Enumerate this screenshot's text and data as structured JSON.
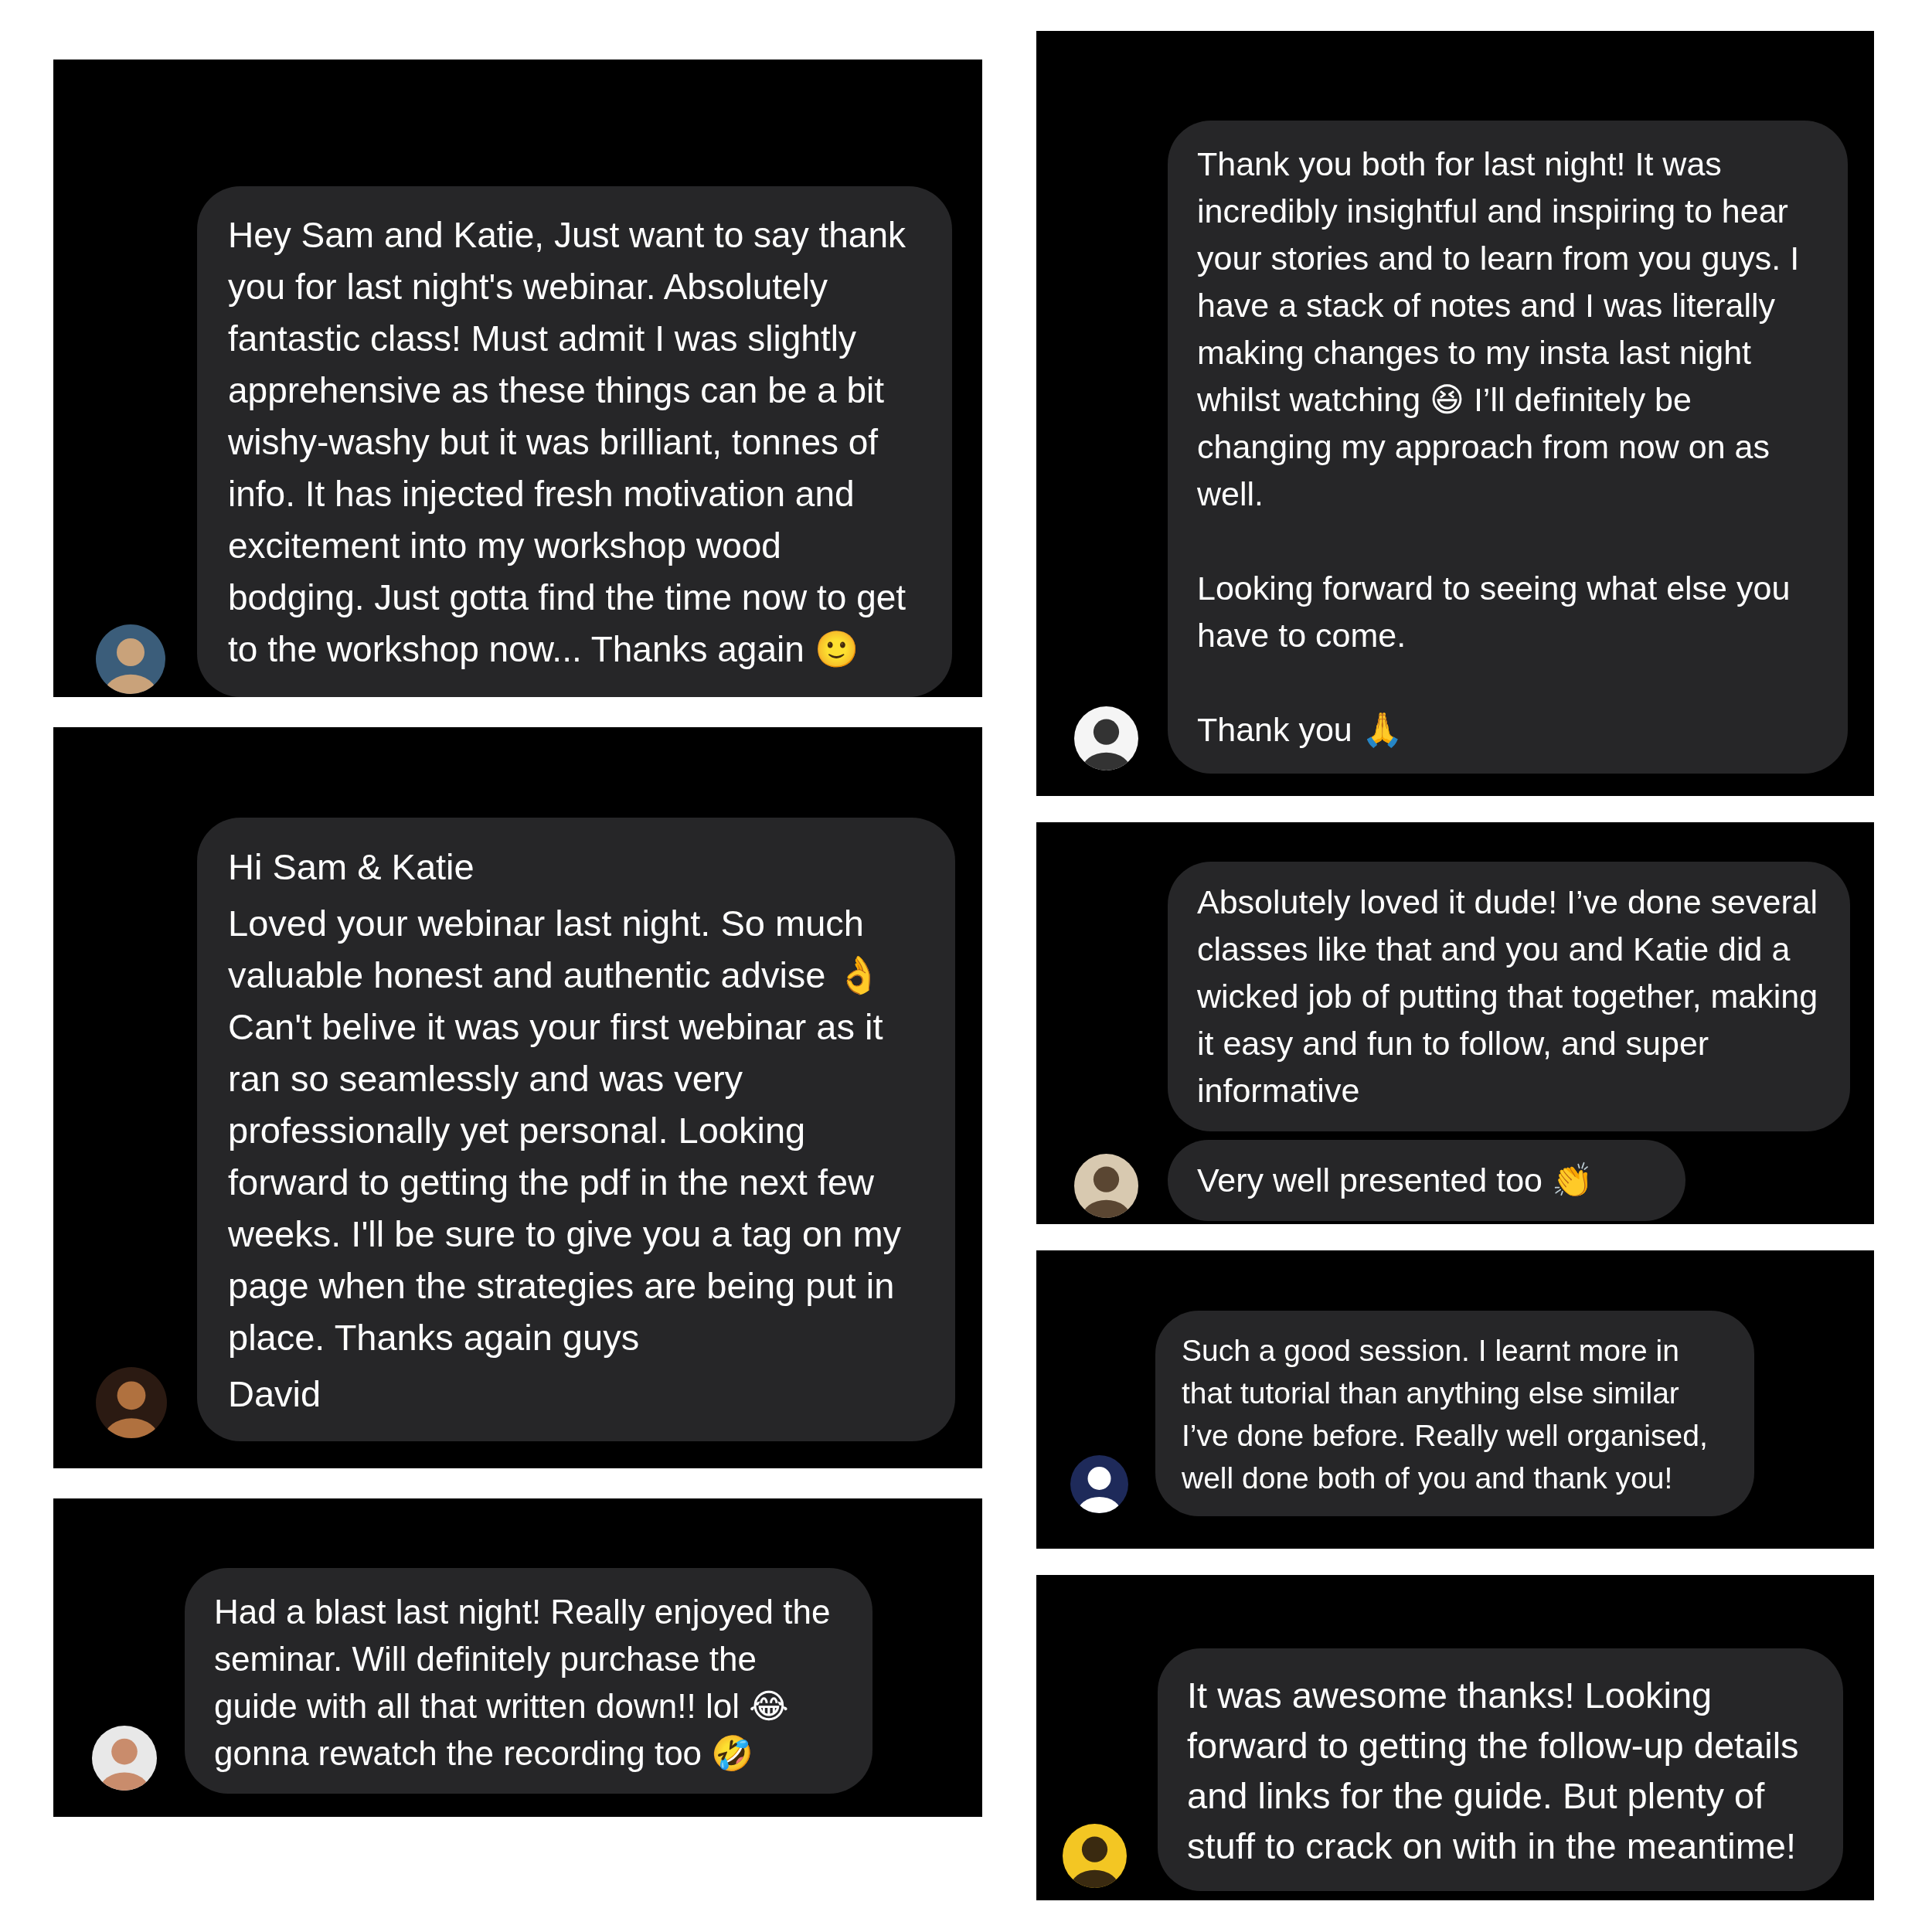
{
  "columns": [
    {
      "panels": [
        {
          "bubbles": [
            {
              "paragraphs": [
                "Hey Sam and Katie, Just want to say thank you for last night's webinar. Absolutely fantastic class! Must admit I was slightly apprehensive as these things can be a bit wishy-washy but it was brilliant, tonnes of info. It has injected fresh motivation and excitement into my workshop wood bodging. Just gotta find the time now to get to the workshop now... Thanks again 🙂"
              ]
            }
          ]
        },
        {
          "bubbles": [
            {
              "paragraphs": [
                "Hi Sam & Katie",
                "Loved your webinar last night. So much valuable honest and authentic advise 👌  Can't belive it was your first webinar as it ran so seamlessly and was very professionally yet personal. Looking forward to getting the pdf in the next few weeks. I'll be sure to give you a tag on my page when the strategies are being put in place. Thanks again guys",
                "David"
              ]
            }
          ]
        },
        {
          "bubbles": [
            {
              "paragraphs": [
                "Had a blast last night! Really enjoyed the seminar. Will definitely purchase the guide with all that written down!! lol 😂 gonna rewatch the recording too 🤣"
              ]
            }
          ]
        }
      ]
    },
    {
      "panels": [
        {
          "bubbles": [
            {
              "paragraphs": [
                "Thank you both for last night! It was incredibly insightful and inspiring to hear your stories and to learn from you guys. I have a stack of notes and I was literally making changes to my insta last night whilst watching 😆 I’ll definitely be changing my approach from now on as well.",
                "Looking forward to seeing what else you have to come.",
                "Thank you 🙏"
              ]
            }
          ]
        },
        {
          "bubbles": [
            {
              "paragraphs": [
                "Absolutely loved it dude! I’ve done several classes like that and you and Katie did a wicked job of putting that together, making it easy and fun to follow, and super informative"
              ]
            },
            {
              "paragraphs": [
                "Very well presented too 👏"
              ]
            }
          ]
        },
        {
          "bubbles": [
            {
              "paragraphs": [
                "Such a good session. I learnt more in that tutorial than anything else similar I’ve done before. Really well organised, well done both of you and thank you!"
              ]
            }
          ]
        },
        {
          "bubbles": [
            {
              "paragraphs": [
                "It was awesome thanks! Looking forward to getting the follow-up details and links for the guide. But plenty of stuff to crack on with in the meantime!"
              ]
            }
          ]
        }
      ]
    }
  ]
}
